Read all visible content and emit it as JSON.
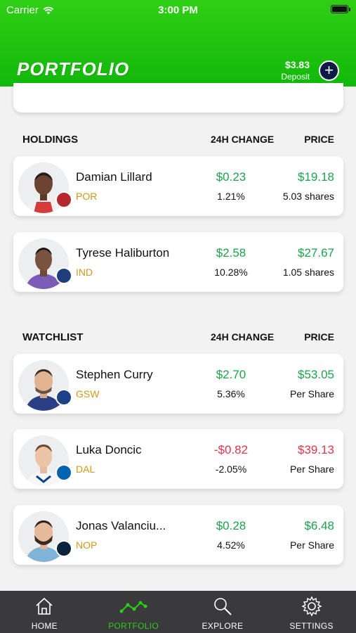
{
  "status": {
    "carrier": "Carrier",
    "time": "3:00 PM"
  },
  "header": {
    "title": "PORTFOLIO",
    "balance": "$3.83",
    "deposit_label": "Deposit",
    "add_symbol": "+"
  },
  "holdings": {
    "title": "HOLDINGS",
    "change_header": "24H CHANGE",
    "price_header": "PRICE",
    "items": [
      {
        "name": "Damian Lillard",
        "team": "POR",
        "change": "$0.23",
        "change_pct": "1.21%",
        "price": "$19.18",
        "sub": "5.03 shares",
        "trend": "up"
      },
      {
        "name": "Tyrese Haliburton",
        "team": "IND",
        "change": "$2.58",
        "change_pct": "10.28%",
        "price": "$27.67",
        "sub": "1.05 shares",
        "trend": "up"
      }
    ]
  },
  "watchlist": {
    "title": "WATCHLIST",
    "change_header": "24H CHANGE",
    "price_header": "PRICE",
    "items": [
      {
        "name": "Stephen Curry",
        "team": "GSW",
        "change": "$2.70",
        "change_pct": "5.36%",
        "price": "$53.05",
        "sub": "Per Share",
        "trend": "up"
      },
      {
        "name": "Luka Doncic",
        "team": "DAL",
        "change": "-$0.82",
        "change_pct": "-2.05%",
        "price": "$39.13",
        "sub": "Per Share",
        "trend": "down"
      },
      {
        "name": "Jonas Valanciu...",
        "team": "NOP",
        "change": "$0.28",
        "change_pct": "4.52%",
        "price": "$6.48",
        "sub": "Per Share",
        "trend": "up"
      }
    ]
  },
  "tabs": [
    {
      "label": "HOME",
      "icon": "home-icon"
    },
    {
      "label": "PORTFOLIO",
      "icon": "portfolio-icon",
      "active": true
    },
    {
      "label": "EXPLORE",
      "icon": "search-icon"
    },
    {
      "label": "SETTINGS",
      "icon": "gear-icon"
    }
  ],
  "colors": {
    "brand_green": "#12b80a",
    "positive": "#1aa34a",
    "negative": "#e0354a",
    "team_gold": "#cf9a17",
    "tabbar": "#3a3a3c"
  }
}
